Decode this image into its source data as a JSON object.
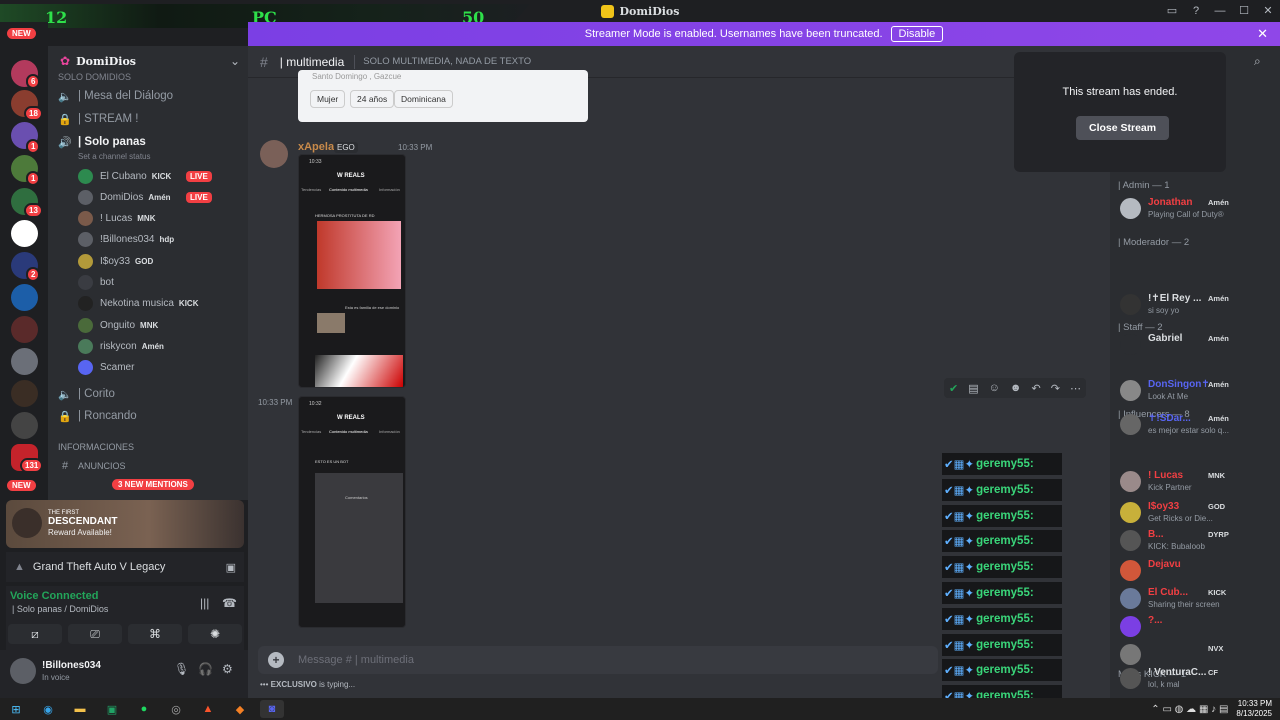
{
  "hud": {
    "left": "12",
    "mid": "PC",
    "right": "50"
  },
  "app": {
    "title": "DomiDios"
  },
  "banner": {
    "text": "Streamer Mode is enabled. Usernames have been truncated.",
    "button": "Disable"
  },
  "rail": {
    "new_top": "NEW",
    "new_bottom": "NEW",
    "badges": [
      "6",
      "18",
      "1",
      "1",
      "13",
      "2",
      "131"
    ]
  },
  "server": {
    "name": "DomiDios",
    "section_partial": "SOLO DOMIDIOS"
  },
  "channels": {
    "mesa": "| Mesa del Diálogo",
    "stream": "| STREAM !",
    "solo_panas": "| Solo panas",
    "set_status": "Set a channel status",
    "corito": "| Corito",
    "roncando": "| Roncando",
    "info_header": "INFORMACIONES",
    "anuncios": "ANUNCIOS",
    "mentions": "3 NEW MENTIONS"
  },
  "voice_users": [
    {
      "name": "El Cubano",
      "tag": "KICK",
      "live": "LIVE"
    },
    {
      "name": "DomiDios",
      "tag": "Amén",
      "live": "LIVE"
    },
    {
      "name": "! Lucas",
      "tag": "MNK",
      "live": ""
    },
    {
      "name": "!Billones034",
      "tag": "hdp",
      "live": ""
    },
    {
      "name": "I$oy33",
      "tag": "GOD",
      "live": ""
    },
    {
      "name": "bot",
      "tag": "",
      "live": ""
    },
    {
      "name": "Nekotina musica",
      "tag": "KICK",
      "live": ""
    },
    {
      "name": "Onguito",
      "tag": "MNK",
      "live": ""
    },
    {
      "name": "riskycon",
      "tag": "Amén",
      "live": ""
    },
    {
      "name": "Scamer",
      "tag": "",
      "live": ""
    }
  ],
  "promo": {
    "brand_small": "THE FIRST",
    "brand": "DESCENDANT",
    "reward": "Reward Available!"
  },
  "activity": {
    "game": "Grand Theft Auto V Legacy"
  },
  "voice": {
    "status": "Voice Connected",
    "location": "| Solo panas / DomiDios"
  },
  "user": {
    "name": "!Billones034",
    "status": "In voice"
  },
  "chat": {
    "channel": "| multimedia",
    "topic": "SOLO MULTIMEDIA, NADA DE TEXTO",
    "card_line": "Santo Domingo , Gazcue",
    "pills": [
      "Mujer",
      "24 años",
      "Dominicana"
    ],
    "author": "xApela",
    "author_tag": "EGO",
    "time1": "10:33 PM",
    "time2": "10:33 PM",
    "shot1": {
      "time": "10:33",
      "title": "W REALS",
      "tabs": [
        "Tendencias",
        "Contenido multimedia",
        "Información"
      ],
      "post_title": "HERMOSA PROSTITUTA DE RD",
      "caption": "Esta es familia de ese dominio"
    },
    "shot2": {
      "time": "10:32",
      "title": "W REALS",
      "tabs": [
        "Tendencias",
        "Contenido multimedia",
        "Información"
      ],
      "post_title": "ESTO ES UN BOT",
      "label": "Comentarios"
    },
    "placeholder": "Message # | multimedia",
    "typing_user": "EXCLUSIVO",
    "typing_text": "is typing..."
  },
  "stream": {
    "ended": "This stream has ended.",
    "close": "Close Stream"
  },
  "overlay_user": "geremy55:",
  "members": {
    "admin": "| Admin — 1",
    "mod": "| Moderador — 2",
    "staff": "| Staff — 2",
    "influencers": "| Influencers — 8",
    "modskick": "Mods KICK — 1",
    "list": [
      {
        "name": "Jonathan",
        "tag": "Amén",
        "status": "Playing Call of Duty®"
      },
      {
        "name": "!✝El Rey ...",
        "tag": "Amén",
        "status": "si soy yo"
      },
      {
        "name": "Gabriel",
        "tag": "Amén",
        "status": ""
      },
      {
        "name": "DonSingon✝",
        "tag": "Amén",
        "status": "Look At Me"
      },
      {
        "name": "✝!SDar...",
        "tag": "Amén",
        "status": "es mejor estar solo q..."
      },
      {
        "name": "! Lucas",
        "tag": "MNK",
        "status": "Kick Partner"
      },
      {
        "name": "I$oy33",
        "tag": "GOD",
        "status": "Get Ricks or Die..."
      },
      {
        "name": "B...",
        "tag": "DYRP",
        "status": "KICK: Bubaloob"
      },
      {
        "name": "Dejavu",
        "tag": "",
        "status": ""
      },
      {
        "name": "El Cub...",
        "tag": "KICK",
        "status": "Sharing their screen"
      },
      {
        "name": "?...",
        "tag": "",
        "status": ""
      },
      {
        "name": "",
        "tag": "NVX",
        "status": ""
      },
      {
        "name": "! VenturaC...",
        "tag": "CF",
        "status": "lol, k mal"
      }
    ]
  },
  "taskbar": {
    "time": "10:33 PM",
    "date": "8/13/2025"
  }
}
